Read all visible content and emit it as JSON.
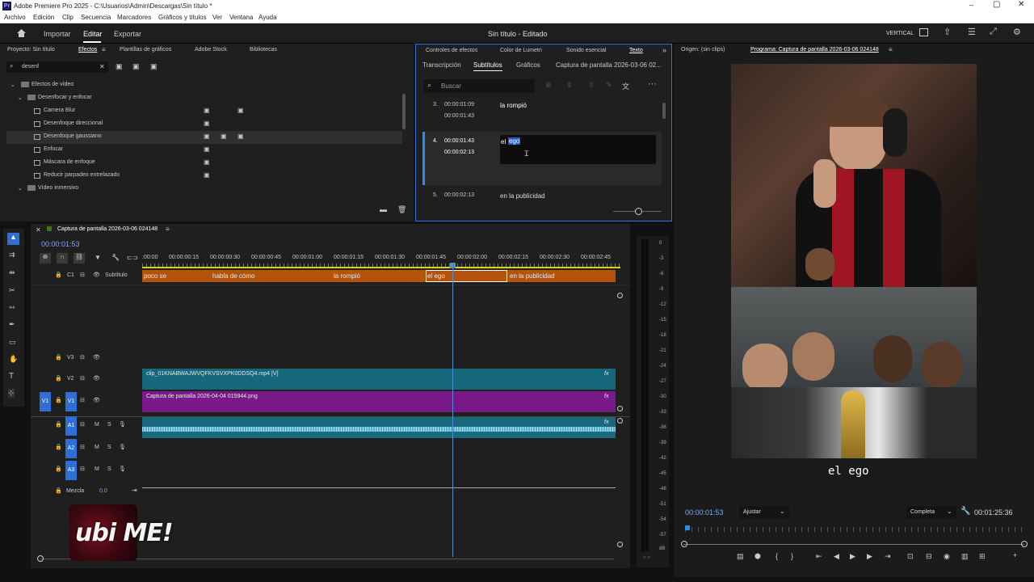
{
  "titlebar": {
    "app": "Adobe Premiere Pro 2025 - C:\\Usuarios\\Admin\\Descargas\\Sin título *"
  },
  "menu": [
    "Archivo",
    "Edición",
    "Clip",
    "Secuencia",
    "Marcadores",
    "Gráficos y títulos",
    "Ver",
    "Ventana",
    "Ayuda"
  ],
  "header": {
    "tabs": [
      "Importar",
      "Editar",
      "Exportar"
    ],
    "active_tab": "Editar",
    "project_title": "Sin título - Editado",
    "layout": "VERTICAL"
  },
  "effects_panel": {
    "tabs": [
      "Proyecto: Sin título",
      "Efectos",
      "Plantillas de gráficos",
      "Adobe Stock",
      "Bibliotecas"
    ],
    "search_value": "desenf",
    "tree": [
      {
        "label": "Efectos de vídeo",
        "level": 0
      },
      {
        "label": "Desenfocar y enfocar",
        "level": 1
      },
      {
        "label": "Camera Blur",
        "level": 2
      },
      {
        "label": "Desenfoque direccional",
        "level": 2
      },
      {
        "label": "Desenfoque gaussiano",
        "level": 2
      },
      {
        "label": "Enfocar",
        "level": 2
      },
      {
        "label": "Máscara de enfoque",
        "level": 2
      },
      {
        "label": "Reducir parpadeo entrelazado",
        "level": 2
      },
      {
        "label": "Vídeo inmersivo",
        "level": 1
      }
    ]
  },
  "text_panel": {
    "tabs": [
      "Controles de efectos",
      "Color de Lumetri",
      "Sonido esencial",
      "Texto"
    ],
    "subtabs": [
      "Transcripción",
      "Subtítulos",
      "Gráficos",
      "Captura de pantalla 2026-03-06 02..."
    ],
    "search_placeholder": "Buscar",
    "entries": [
      {
        "num": "3.",
        "in": "00:00:01:09",
        "out": "00:00:01:43",
        "text": "la rompió"
      },
      {
        "num": "4.",
        "in": "00:00:01:43",
        "out": "00:00:02:13",
        "text_plain": "el ",
        "text_sel": "ego"
      },
      {
        "num": "5.",
        "in": "00:00:02:13",
        "out": "",
        "text": "en la publicidad"
      }
    ]
  },
  "source": {
    "label": "Origen: (sin clips)",
    "program": "Programa: Captura de pantalla 2026-03-06 024148"
  },
  "timeline": {
    "sequence": "Captura de pantalla 2026-03-06 024148",
    "timecode": "00:00:01:53",
    "ruler": [
      ":00:00",
      "00:00:00:15",
      "00:00:00:30",
      "00:00:00:45",
      "00:00:01:00",
      "00:00:01:15",
      "00:00:01:30",
      "00:00:01:45",
      "00:00:02:00",
      "00:00:02:15",
      "00:00:02:30",
      "00:00:02:45"
    ],
    "caption_track": "Subtítulo",
    "captions": [
      "poco se",
      "habla de cómo",
      "la rompió",
      "el ego",
      "en la publicidad"
    ],
    "tracks": {
      "c1": "C1",
      "v3": "V3",
      "v2": "V2",
      "v1": "V1",
      "a1": "A1",
      "a2": "A2",
      "a3": "A3"
    },
    "mix_label": "Mezcla",
    "mix_value": "0,0",
    "v2_clip": "clip_01KNABWAJWVQFKVSVXPK0DDSQ4.mp4 [V]",
    "v1_clip": "Captura de pantalla 2026-04-04 015944.png",
    "fx": "fx",
    "ms": [
      "M",
      "S"
    ]
  },
  "meter_ticks": [
    "0",
    "-3",
    "-6",
    "-9",
    "-12",
    "-15",
    "-18",
    "-21",
    "-24",
    "-27",
    "-30",
    "-33",
    "-36",
    "-39",
    "-42",
    "-45",
    "-48",
    "-51",
    "-54",
    "-57",
    "dB"
  ],
  "meter_bottom": "○ ○",
  "program_monitor": {
    "timecode": "00:00:01:53",
    "fit": "Ajustar",
    "quality": "Completa",
    "duration": "00:01:25:36",
    "caption_text": "el ego"
  },
  "watermark": {
    "text": "ubi ME!"
  },
  "colors": {
    "caption_clip": "#b5520c",
    "v2_clip": "#15687a",
    "v1_clip": "#7a1a8a",
    "audio": "#1a6880",
    "accent": "#2d8ceb",
    "playhead": "#4d8ed4"
  }
}
